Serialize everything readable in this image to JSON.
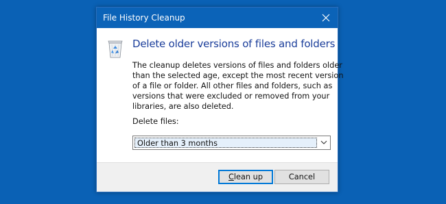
{
  "window": {
    "title": "File History Cleanup",
    "close_icon": "close-icon"
  },
  "content": {
    "icon": "recycle-bin-icon",
    "heading": "Delete older versions of files and folders",
    "description_lines": [
      "The cleanup deletes versions of files and folders older",
      "than the selected age, except the most recent version",
      "of a file or folder. All other files and folders, such as",
      "versions that were excluded or removed from your",
      "libraries, are also deleted."
    ],
    "delete_files_label": "Delete files:",
    "delete_files_select": {
      "value": "Older than 3 months"
    }
  },
  "buttons": {
    "cleanup_accel": "C",
    "cleanup_rest": "lean up",
    "cancel": "Cancel"
  },
  "colors": {
    "desktop": "#0a61b5",
    "titlebar": "#0b63b8",
    "heading": "#1a3d9a",
    "primary_button_border": "#0078d7"
  }
}
